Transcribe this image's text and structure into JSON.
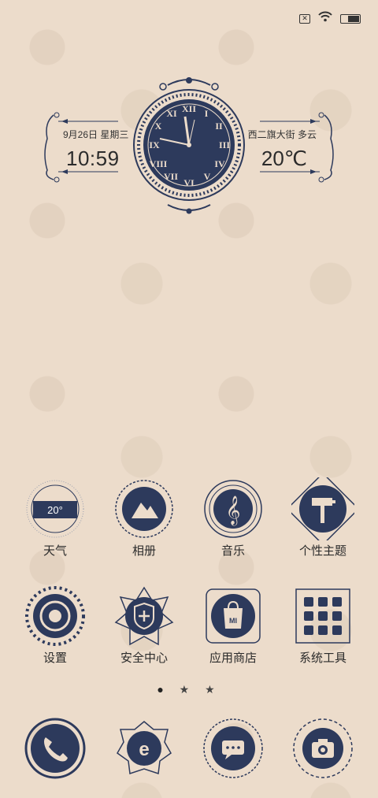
{
  "status": {
    "sim": "✕",
    "wifi_icon": "wifi-icon",
    "battery_icon": "battery-icon"
  },
  "widget": {
    "date": "9月26日 星期三",
    "time": "10:59",
    "location_weather": "西二旗大街  多云",
    "temperature": "20℃"
  },
  "apps_row1": [
    {
      "label": "天气",
      "icon": "weather-icon",
      "badge": "20°"
    },
    {
      "label": "相册",
      "icon": "mountain-icon"
    },
    {
      "label": "音乐",
      "icon": "treble-clef-icon"
    },
    {
      "label": "个性主题",
      "icon": "paint-roller-icon"
    }
  ],
  "apps_row2": [
    {
      "label": "设置",
      "icon": "gear-icon"
    },
    {
      "label": "安全中心",
      "icon": "shield-icon"
    },
    {
      "label": "应用商店",
      "icon": "shopping-bag-icon",
      "badge": "MI"
    },
    {
      "label": "系统工具",
      "icon": "grid-icon"
    }
  ],
  "page_indicator": [
    "●",
    "★",
    "★"
  ],
  "dock": [
    {
      "icon": "phone-icon"
    },
    {
      "icon": "browser-icon"
    },
    {
      "icon": "message-icon"
    },
    {
      "icon": "camera-icon"
    }
  ],
  "colors": {
    "navy": "#2d3a5c",
    "cream": "#ecdccb",
    "ink": "#2b2b2b"
  }
}
